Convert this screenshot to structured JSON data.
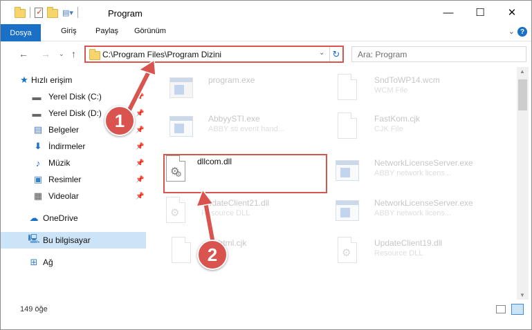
{
  "window": {
    "title": "Program",
    "controls": {
      "minimize": "—",
      "maximize": "☐",
      "close": "✕"
    }
  },
  "ribbon": {
    "tabs": [
      "Dosya",
      "Giriş",
      "Paylaş",
      "Görünüm"
    ],
    "help": "?"
  },
  "address": {
    "path": "C:\\Program Files\\Program Dizini"
  },
  "search": {
    "placeholder": "Ara: Program"
  },
  "sidebar": {
    "quick_access": "Hızlı erişim",
    "items": [
      {
        "label": "Yerel Disk (C:)",
        "icon": "drive-icon",
        "pinned": true
      },
      {
        "label": "Yerel Disk (D:)",
        "icon": "drive-icon",
        "pinned": true
      },
      {
        "label": "Belgeler",
        "icon": "documents-icon",
        "pinned": true
      },
      {
        "label": "İndirmeler",
        "icon": "download-icon",
        "pinned": true
      },
      {
        "label": "Müzik",
        "icon": "music-icon",
        "pinned": true
      },
      {
        "label": "Resimler",
        "icon": "pictures-icon",
        "pinned": true
      },
      {
        "label": "Videolar",
        "icon": "videos-icon",
        "pinned": true
      }
    ],
    "onedrive": "OneDrive",
    "this_pc": "Bu bilgisayar",
    "network": "Ağ"
  },
  "files": [
    {
      "name": "program.exe",
      "desc": "",
      "type": "exe-setup",
      "faded": true
    },
    {
      "name": "SndToWP14.wcm",
      "desc": "WCM File",
      "type": "doc",
      "faded": true
    },
    {
      "name": "AbbyySTI.exe",
      "desc": "ABBY sti event hand...",
      "type": "exe",
      "faded": true
    },
    {
      "name": "FastKom.cjk",
      "desc": "CJK File",
      "type": "doc",
      "faded": true
    },
    {
      "name": "dllcom.dll",
      "desc": "",
      "type": "dll",
      "faded": false
    },
    {
      "name": "NetworkLicenseServer.exe",
      "desc": "ABBY network licens...",
      "type": "exe",
      "faded": true
    },
    {
      "name": "UpdateClient21.dll",
      "desc": "Resource DLL",
      "type": "dll",
      "faded": true
    },
    {
      "name": "NetworkLicenseServer.exe",
      "desc": "ABBY network licens...",
      "type": "exe",
      "faded": true
    },
    {
      "name": "Euhtml.cjk",
      "desc": "",
      "type": "doc",
      "faded": true
    },
    {
      "name": "UpdateClient19.dll",
      "desc": "Resource DLL",
      "type": "dll",
      "faded": true
    }
  ],
  "status": {
    "count": "149 öğe"
  },
  "annotations": {
    "step1": "1",
    "step2": "2",
    "color": "#d9534f"
  }
}
